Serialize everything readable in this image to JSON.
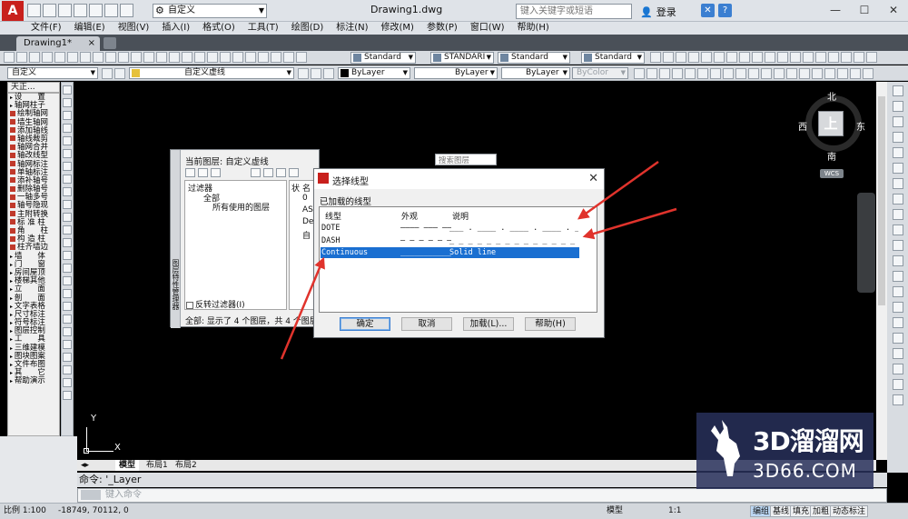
{
  "titlebar": {
    "workspace": "自定义",
    "document_title": "Drawing1.dwg",
    "search_placeholder": "键入关键字或短语",
    "login": "登录",
    "help": "?",
    "window_controls": [
      "—",
      "☐",
      "✕"
    ]
  },
  "menubar": [
    "文件(F)",
    "编辑(E)",
    "视图(V)",
    "插入(I)",
    "格式(O)",
    "工具(T)",
    "绘图(D)",
    "标注(N)",
    "修改(M)",
    "参数(P)",
    "窗口(W)",
    "帮助(H)"
  ],
  "doc_tabs": [
    {
      "label": "Drawing1*",
      "close": "×"
    }
  ],
  "toolbar1": {
    "text_style": "Standard",
    "dim_style": "STANDARI",
    "table_style": "Standard",
    "mleader_style": "Standard"
  },
  "toolbar2": {
    "workspace_combo": "自定义",
    "layer_combo": "自定义虚线",
    "color": "ByLayer",
    "linetype": "ByLayer",
    "lineweight": "ByLayer",
    "plotstyle": "ByColor"
  },
  "palette": {
    "title": "天正...",
    "items": [
      {
        "type": "hdr",
        "label": "设　　置"
      },
      {
        "type": "hdr",
        "label": "轴网柱子"
      },
      {
        "type": "it",
        "label": "绘制轴网"
      },
      {
        "type": "it",
        "label": "墙生轴网"
      },
      {
        "type": "it",
        "label": "添加轴线"
      },
      {
        "type": "it",
        "label": "轴线裁剪"
      },
      {
        "type": "it",
        "label": "轴网合并"
      },
      {
        "type": "it",
        "label": "轴改线型"
      },
      {
        "type": "it",
        "label": "轴网标注"
      },
      {
        "type": "it",
        "label": "单轴标注"
      },
      {
        "type": "it",
        "label": "添补轴号"
      },
      {
        "type": "it",
        "label": "删除轴号"
      },
      {
        "type": "it",
        "label": "一轴多号"
      },
      {
        "type": "it",
        "label": "轴号隐现"
      },
      {
        "type": "it",
        "label": "主附转换"
      },
      {
        "type": "it",
        "label": "标 准 柱"
      },
      {
        "type": "it",
        "label": "角　　柱"
      },
      {
        "type": "it",
        "label": "构 造 柱"
      },
      {
        "type": "it",
        "label": "柱齐墙边"
      },
      {
        "type": "hdr",
        "label": "墙　　体"
      },
      {
        "type": "hdr",
        "label": "门　　窗"
      },
      {
        "type": "hdr",
        "label": "房间屋顶"
      },
      {
        "type": "hdr",
        "label": "楼梯其他"
      },
      {
        "type": "hdr",
        "label": "立　　面"
      },
      {
        "type": "hdr",
        "label": "剖　　面"
      },
      {
        "type": "hdr",
        "label": "文字表格"
      },
      {
        "type": "hdr",
        "label": "尺寸标注"
      },
      {
        "type": "hdr",
        "label": "符号标注"
      },
      {
        "type": "hdr",
        "label": "图层控制"
      },
      {
        "type": "hdr",
        "label": "工　　具"
      },
      {
        "type": "hdr",
        "label": "三维建模"
      },
      {
        "type": "hdr",
        "label": "图块图案"
      },
      {
        "type": "hdr",
        "label": "文件布图"
      },
      {
        "type": "hdr",
        "label": "其　　它"
      },
      {
        "type": "hdr",
        "label": "帮助演示"
      }
    ]
  },
  "viewcube": {
    "north": "北",
    "south": "南",
    "east": "东",
    "west": "西",
    "face": "上",
    "wcs": "WCS"
  },
  "ucs": {
    "x": "X",
    "y": "Y"
  },
  "layout_tabs": [
    "模型",
    "布局1",
    "布局2"
  ],
  "command": {
    "history": "命令:  '_Layer",
    "placeholder": "键入命令"
  },
  "statusbar": {
    "scale": "比例 1:100",
    "coords": "-18749, 70112, 0",
    "model": "模型",
    "annoscale": "1:1",
    "toggles": [
      "编组",
      "基线",
      "填充",
      "加粗",
      "动态标注"
    ]
  },
  "layer_manager": {
    "current_layer": "当前图层: 自定义虚线",
    "search_placeholder": "搜索图层",
    "filters_header": "过滤器",
    "tree_all": "全部",
    "tree_used": "所有使用的图层",
    "col_status": "状",
    "col_name": "名",
    "layers": [
      "0",
      "AS",
      "De",
      "自"
    ],
    "invert_filter": "反转过滤器(I)",
    "status": "全部: 显示了 4 个图层，共 4 个图层",
    "side_label": "图层特性管理器"
  },
  "dialog": {
    "title": "选择线型",
    "close": "✕",
    "loaded_label": "已加载的线型",
    "headers": {
      "linetype": "线型",
      "appearance": "外观",
      "description": "说明"
    },
    "rows": [
      {
        "name": "DOTE",
        "appearance": "———— ——— ——— ———",
        "description": "___ . ____ . ____ . ____ . ____",
        "selected": false
      },
      {
        "name": "DASH",
        "appearance": "— — — — — — — — —",
        "description": "_ _ _ _ _ _ _ _ _ _ _ _ _ _ _ _ _",
        "selected": false
      },
      {
        "name": "Continuous",
        "appearance": "_____________",
        "description": "Solid line",
        "selected": true
      }
    ],
    "buttons": {
      "ok": "确定",
      "cancel": "取消",
      "load": "加载(L)...",
      "help": "帮助(H)"
    }
  },
  "watermark": {
    "line1": "3D溜溜网",
    "line2": "3D66.COM"
  },
  "colors": {
    "accent": "#1a6fd1",
    "annotation_arrow": "#e0332c",
    "autocad_red": "#c8201c"
  }
}
